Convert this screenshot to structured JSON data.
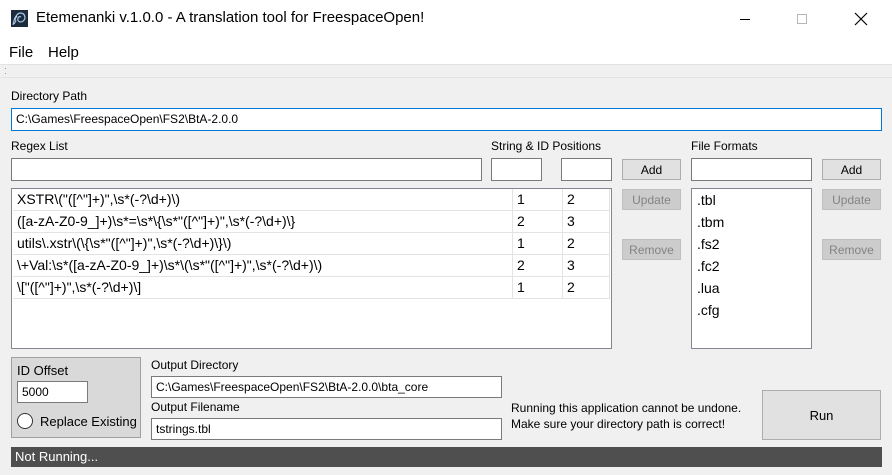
{
  "window": {
    "title": "Etemenanki v.1.0.0 - A translation tool for FreespaceOpen!",
    "app_icon": "spiral-app-icon",
    "controls": [
      "minimize-icon",
      "maximize-icon",
      "close-icon"
    ]
  },
  "menu": {
    "file": "File",
    "help": "Help"
  },
  "directory": {
    "label": "Directory Path",
    "value": "C:\\Games\\FreespaceOpen\\FS2\\BtA-2.0.0"
  },
  "regex": {
    "label": "Regex List",
    "positions_label": "String & ID Positions",
    "input_value": "",
    "string_pos_value": "",
    "id_pos_value": "",
    "add_label": "Add",
    "update_label": "Update",
    "remove_label": "Remove",
    "rows": [
      {
        "pattern": "XSTR\\(\"([^\"]+)\",\\s*(-?\\d+)\\)",
        "string_pos": "1",
        "id_pos": "2"
      },
      {
        "pattern": "([a-zA-Z0-9_]+)\\s*=\\s*\\{\\s*\"([^\"]+)\",\\s*(-?\\d+)\\}",
        "string_pos": "2",
        "id_pos": "3"
      },
      {
        "pattern": "utils\\.xstr\\(\\{\\s*\"([^\"]+)\",\\s*(-?\\d+)\\}\\)",
        "string_pos": "1",
        "id_pos": "2"
      },
      {
        "pattern": "\\+Val:\\s*([a-zA-Z0-9_]+)\\s*\\(\\s*\"([^\"]+)\",\\s*(-?\\d+)\\)",
        "string_pos": "2",
        "id_pos": "3"
      },
      {
        "pattern": "\\[\"([^\"]+)\",\\s*(-?\\d+)\\]",
        "string_pos": "1",
        "id_pos": "2"
      }
    ]
  },
  "formats": {
    "label": "File Formats",
    "input_value": "",
    "add_label": "Add",
    "update_label": "Update",
    "remove_label": "Remove",
    "items": [
      ".tbl",
      ".tbm",
      ".fs2",
      ".fc2",
      ".lua",
      ".cfg"
    ]
  },
  "id_offset": {
    "label": "ID Offset",
    "value": "5000",
    "replace_label": "Replace Existing",
    "replace_checked": false
  },
  "output": {
    "dir_label": "Output Directory",
    "dir_value": "C:\\Games\\FreespaceOpen\\FS2\\BtA-2.0.0\\bta_core",
    "file_label": "Output Filename",
    "file_value": "tstrings.tbl"
  },
  "warning": {
    "line1": "Running this application cannot be undone.",
    "line2": "Make sure your directory path is correct!"
  },
  "run_label": "Run",
  "status": "Not Running..."
}
